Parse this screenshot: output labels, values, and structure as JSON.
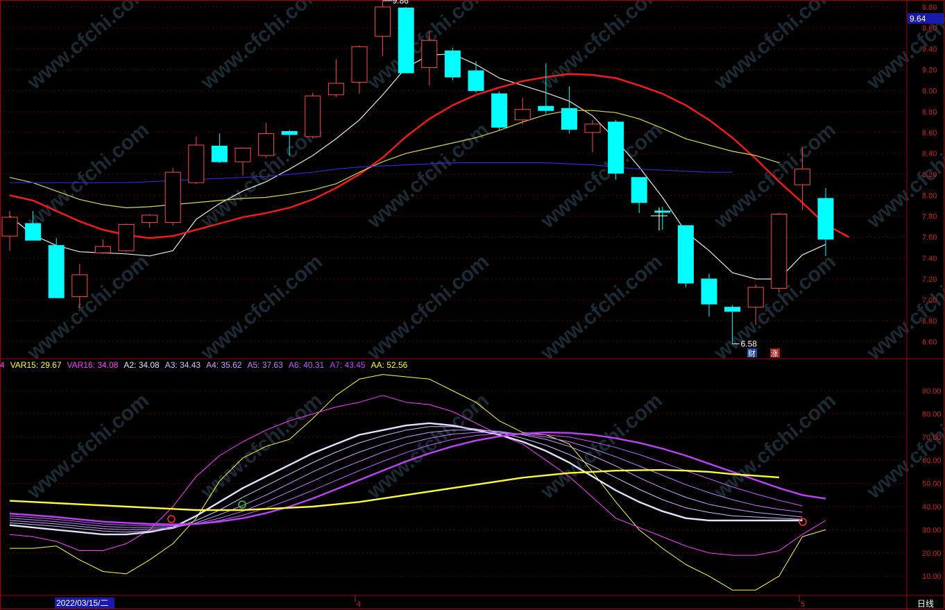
{
  "colors": {
    "background": "#000000",
    "grid": "#5a0000",
    "border": "#a00000",
    "axis_text": "#cc2222",
    "up_candle": "#ff4a4a",
    "down_candle": "#00ffff",
    "ma_white": "#e8e8e8",
    "ma_red": "#ff1a1a",
    "ma_yellow": "#d9d94a",
    "ma_blue": "#2b2bd9",
    "price_tag_bg": "#1a1aaa"
  },
  "price_panel": {
    "current_price_tag": "9.64",
    "y_ticks": [
      "9.80",
      "9.60",
      "9.40",
      "9.20",
      "9.00",
      "8.80",
      "8.60",
      "8.40",
      "8.20",
      "8.00",
      "7.80",
      "7.60",
      "7.40",
      "7.20",
      "7.00",
      "6.80",
      "6.60"
    ],
    "high_marker": "9.86",
    "low_marker": "6.58",
    "event_badges": [
      "财",
      "涨"
    ]
  },
  "indicator_panel": {
    "legend": [
      {
        "label": "4",
        "color": "#ff40ff"
      },
      {
        "label": "VAR15: 29.67",
        "color": "#ffff33"
      },
      {
        "label": "VAR16: 34.08",
        "color": "#ff40ff"
      },
      {
        "label": "A2: 34.08",
        "color": "#e0e0ff"
      },
      {
        "label": "A3: 34.43",
        "color": "#d0c0ff"
      },
      {
        "label": "A4: 35.62",
        "color": "#c8a0ff"
      },
      {
        "label": "A5: 37.63",
        "color": "#c080ff"
      },
      {
        "label": "A6: 40.31",
        "color": "#c060ff"
      },
      {
        "label": "A7: 43.45",
        "color": "#c040ff"
      },
      {
        "label": "AA: 52.56",
        "color": "#ffff33"
      }
    ],
    "y_ticks": [
      "90.00",
      "80.00",
      "70.00",
      "60.00",
      "50.00",
      "40.00",
      "30.00",
      "20.00",
      "10.00"
    ]
  },
  "time_axis": {
    "date_label": "2022/03/15/二",
    "month_markers": [
      "4",
      "5"
    ],
    "period_label": "日线"
  },
  "watermark": "www.cfchi.com",
  "chart_data": [
    {
      "type": "candlestick",
      "title": "",
      "ylim": [
        6.5,
        9.85
      ],
      "candles": [
        {
          "o": 7.61,
          "h": 7.85,
          "l": 7.47,
          "c": 7.79
        },
        {
          "o": 7.73,
          "h": 7.85,
          "l": 7.58,
          "c": 7.57
        },
        {
          "o": 7.52,
          "h": 7.59,
          "l": 7.02,
          "c": 7.02
        },
        {
          "o": 7.03,
          "h": 7.34,
          "l": 6.92,
          "c": 7.24
        },
        {
          "o": 7.45,
          "h": 7.58,
          "l": 7.44,
          "c": 7.51
        },
        {
          "o": 7.47,
          "h": 7.73,
          "l": 7.46,
          "c": 7.72
        },
        {
          "o": 7.74,
          "h": 7.82,
          "l": 7.69,
          "c": 7.81
        },
        {
          "o": 7.74,
          "h": 8.26,
          "l": 7.71,
          "c": 8.22
        },
        {
          "o": 8.12,
          "h": 8.56,
          "l": 8.11,
          "c": 8.48
        },
        {
          "o": 8.47,
          "h": 8.59,
          "l": 8.31,
          "c": 8.32
        },
        {
          "o": 8.32,
          "h": 8.45,
          "l": 8.19,
          "c": 8.45
        },
        {
          "o": 8.38,
          "h": 8.69,
          "l": 8.36,
          "c": 8.59
        },
        {
          "o": 8.61,
          "h": 8.62,
          "l": 8.38,
          "c": 8.58
        },
        {
          "o": 8.56,
          "h": 8.98,
          "l": 8.54,
          "c": 8.95
        },
        {
          "o": 8.96,
          "h": 9.3,
          "l": 8.94,
          "c": 9.07
        },
        {
          "o": 9.08,
          "h": 9.43,
          "l": 8.97,
          "c": 9.42
        },
        {
          "o": 9.52,
          "h": 9.86,
          "l": 9.33,
          "c": 9.8
        },
        {
          "o": 9.79,
          "h": 9.8,
          "l": 9.17,
          "c": 9.17
        },
        {
          "o": 9.22,
          "h": 9.57,
          "l": 9.05,
          "c": 9.48
        },
        {
          "o": 9.38,
          "h": 9.41,
          "l": 9.1,
          "c": 9.13
        },
        {
          "o": 9.19,
          "h": 9.28,
          "l": 8.98,
          "c": 9.0
        },
        {
          "o": 8.97,
          "h": 8.99,
          "l": 8.62,
          "c": 8.65
        },
        {
          "o": 8.72,
          "h": 8.93,
          "l": 8.68,
          "c": 8.82
        },
        {
          "o": 8.85,
          "h": 9.26,
          "l": 8.78,
          "c": 8.81
        },
        {
          "o": 8.83,
          "h": 9.04,
          "l": 8.59,
          "c": 8.63
        },
        {
          "o": 8.6,
          "h": 8.72,
          "l": 8.41,
          "c": 8.68
        },
        {
          "o": 8.7,
          "h": 8.72,
          "l": 8.15,
          "c": 8.21
        },
        {
          "o": 8.17,
          "h": 8.17,
          "l": 7.83,
          "c": 7.93
        },
        {
          "o": 7.85,
          "h": 7.89,
          "l": 7.67,
          "c": 7.84
        },
        {
          "o": 7.71,
          "h": 7.71,
          "l": 7.12,
          "c": 7.16
        },
        {
          "o": 7.2,
          "h": 7.25,
          "l": 6.84,
          "c": 6.96
        },
        {
          "o": 6.93,
          "h": 6.95,
          "l": 6.58,
          "c": 6.89
        },
        {
          "o": 6.93,
          "h": 7.15,
          "l": 6.76,
          "c": 7.12
        },
        {
          "o": 7.11,
          "h": 7.83,
          "l": 7.07,
          "c": 7.82
        },
        {
          "o": 8.1,
          "h": 8.46,
          "l": 7.86,
          "c": 8.25
        },
        {
          "o": 7.97,
          "h": 8.07,
          "l": 7.42,
          "c": 7.58
        }
      ],
      "series": [
        {
          "color": "#e8e8e8",
          "values": [
            7.8,
            7.62,
            7.52,
            7.46,
            7.45,
            7.44,
            7.42,
            7.47,
            7.77,
            7.92,
            8.04,
            8.13,
            8.25,
            8.38,
            8.54,
            8.72,
            8.96,
            9.22,
            9.34,
            9.35,
            9.25,
            9.12,
            9.05,
            8.98,
            8.9,
            8.76,
            8.53,
            8.27,
            7.98,
            7.65,
            7.47,
            7.26,
            7.2,
            7.2,
            7.43,
            7.53
          ]
        },
        {
          "color": "#ff1a1a",
          "values": [
            8.0,
            7.95,
            7.85,
            7.75,
            7.67,
            7.62,
            7.59,
            7.61,
            7.67,
            7.73,
            7.79,
            7.83,
            7.88,
            7.96,
            8.07,
            8.2,
            8.36,
            8.56,
            8.73,
            8.86,
            8.96,
            9.03,
            9.09,
            9.13,
            9.16,
            9.15,
            9.12,
            9.05,
            8.97,
            8.86,
            8.72,
            8.55,
            8.35,
            8.13,
            7.93,
            7.72,
            7.6
          ]
        },
        {
          "color": "#d9d94a",
          "values": [
            8.17,
            8.12,
            8.04,
            7.96,
            7.91,
            7.88,
            7.89,
            7.91,
            7.93,
            7.95,
            7.97,
            7.98,
            8.01,
            8.05,
            8.11,
            8.22,
            8.32,
            8.4,
            8.45,
            8.5,
            8.55,
            8.62,
            8.7,
            8.77,
            8.81,
            8.81,
            8.79,
            8.73,
            8.64,
            8.54,
            8.48,
            8.42,
            8.38,
            8.31
          ]
        },
        {
          "color": "#2b2bd9",
          "values": [
            8.12,
            8.12,
            8.12,
            8.12,
            8.12,
            8.12,
            8.13,
            8.14,
            8.15,
            8.16,
            8.17,
            8.18,
            8.2,
            8.22,
            8.25,
            8.27,
            8.28,
            8.29,
            8.3,
            8.31,
            8.31,
            8.31,
            8.31,
            8.31,
            8.3,
            8.29,
            8.27,
            8.25,
            8.24,
            8.23,
            8.22,
            8.22
          ]
        }
      ]
    },
    {
      "type": "line",
      "title": "",
      "ylim": [
        0,
        100
      ],
      "series": [
        {
          "name": "VAR15",
          "color": "#ffff33",
          "width": 1,
          "values": [
            22,
            22,
            23,
            17,
            12,
            11,
            17,
            24,
            35,
            51,
            61,
            66,
            69,
            78,
            88,
            95,
            97,
            96,
            95,
            90,
            85,
            77,
            72,
            71,
            67,
            55,
            42,
            30,
            22,
            15,
            10,
            4,
            4,
            10,
            27,
            30
          ]
        },
        {
          "name": "VAR16",
          "color": "#ff40ff",
          "width": 1,
          "values": [
            28,
            27,
            25,
            21,
            21,
            24,
            30,
            40,
            53,
            62,
            68,
            73,
            77,
            80,
            83,
            85,
            88,
            85,
            84,
            81,
            76,
            71,
            67,
            60,
            53,
            44,
            35,
            31,
            27,
            23,
            20,
            19,
            19,
            21,
            28,
            34
          ]
        },
        {
          "name": "A2",
          "color": "#e0e0ff",
          "width": 2.4,
          "values": [
            32,
            31,
            30,
            29,
            28,
            28,
            29,
            31,
            36,
            42,
            48,
            53,
            58,
            63,
            67,
            71,
            73,
            75,
            76,
            75,
            73,
            71,
            68,
            64,
            59,
            53,
            47,
            42,
            38,
            35,
            34,
            34,
            34,
            34,
            34
          ]
        },
        {
          "name": "A3",
          "color": "#d0c0ff",
          "width": 1,
          "values": [
            33,
            32.3,
            31.5,
            30.5,
            29.5,
            29,
            29.5,
            30.5,
            34,
            38.5,
            44,
            49,
            54,
            59,
            63.5,
            67.5,
            70.5,
            73,
            74.5,
            74.5,
            73.5,
            72,
            69.5,
            66.5,
            62.5,
            57.5,
            52.5,
            47.5,
            43,
            39.5,
            37.5,
            36,
            35.5,
            35,
            34.5
          ]
        },
        {
          "name": "A4",
          "color": "#c8a0ff",
          "width": 1,
          "values": [
            34,
            33.3,
            32.5,
            31.5,
            30.5,
            30,
            30.2,
            30.8,
            33,
            36.5,
            40.5,
            45,
            50,
            55,
            59.5,
            63.5,
            67,
            70,
            72,
            73,
            73,
            72.5,
            71,
            69,
            66,
            62,
            57.5,
            52.5,
            48,
            44,
            41,
            39,
            37.5,
            36.5,
            35.5
          ]
        },
        {
          "name": "A5",
          "color": "#c080ff",
          "width": 1,
          "values": [
            35,
            34.3,
            33.5,
            32.5,
            31.5,
            31,
            31,
            31.3,
            32.5,
            35,
            38,
            42,
            46.5,
            51,
            55.5,
            59.5,
            63.5,
            67,
            69.5,
            71.3,
            72,
            72,
            71.3,
            70,
            68,
            65,
            61.5,
            57.5,
            53.5,
            49.5,
            46,
            43,
            40.5,
            38.8,
            37.6
          ]
        },
        {
          "name": "A6",
          "color": "#c060ff",
          "width": 1,
          "values": [
            36,
            35.3,
            34.5,
            33.5,
            32.5,
            32,
            31.8,
            31.8,
            32.4,
            34,
            36.3,
            39.3,
            43,
            47,
            51.3,
            55.5,
            59.5,
            63.3,
            66.5,
            69,
            70.7,
            71.5,
            71.5,
            71,
            70,
            68,
            65.5,
            62.5,
            59,
            55.5,
            52,
            48.5,
            45.5,
            42.7,
            40.3
          ]
        },
        {
          "name": "A7",
          "color": "#c040ff",
          "width": 2.4,
          "values": [
            37,
            36.3,
            35.5,
            34.5,
            33.5,
            33,
            32.5,
            32.3,
            32.5,
            33.5,
            35,
            37.2,
            40,
            43.5,
            47.5,
            51.5,
            55.5,
            59.5,
            63,
            66,
            68.5,
            70.3,
            71.5,
            72,
            71.8,
            71,
            69.5,
            67.5,
            65,
            62,
            58.5,
            55,
            51.5,
            48,
            45,
            43.4
          ]
        },
        {
          "name": "AA",
          "color": "#ffff33",
          "width": 2.4,
          "values": [
            42.5,
            42,
            41.5,
            41,
            40.5,
            40,
            39.5,
            39,
            38.5,
            38.5,
            38.5,
            39,
            39.5,
            40,
            41,
            42,
            43.5,
            45,
            46.5,
            48,
            49.5,
            51,
            52.5,
            53.5,
            54.5,
            55,
            55.5,
            55.7,
            55.8,
            55.5,
            55,
            54,
            53.3,
            52.6
          ]
        }
      ]
    }
  ]
}
